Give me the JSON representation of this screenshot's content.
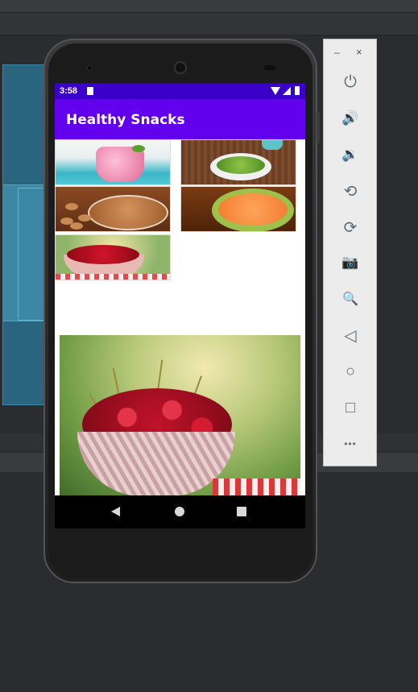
{
  "emulator": {
    "minimize_glyph": "–",
    "close_glyph": "×",
    "tools": [
      {
        "name": "power-icon",
        "glyph": "⏻"
      },
      {
        "name": "volume-up-icon",
        "glyph": "🔊"
      },
      {
        "name": "volume-down-icon",
        "glyph": "🔉"
      },
      {
        "name": "rotate-left-icon",
        "glyph": "⟲"
      },
      {
        "name": "rotate-right-icon",
        "glyph": "⟳"
      },
      {
        "name": "camera-icon",
        "glyph": "📷"
      },
      {
        "name": "zoom-icon",
        "glyph": "🔍"
      },
      {
        "name": "back-icon",
        "glyph": "◁"
      },
      {
        "name": "home-icon",
        "glyph": "○"
      },
      {
        "name": "overview-icon",
        "glyph": "□"
      },
      {
        "name": "more-icon",
        "glyph": "•••"
      }
    ]
  },
  "device": {
    "status_bar": {
      "time": "3:58"
    },
    "app": {
      "title": "Healthy Snacks",
      "accent": "#6200ee",
      "status_color": "#3a00c9"
    },
    "thumbnails": [
      "smoothie-image",
      "edamame-image",
      "almonds-image",
      "apricots-image",
      "cherries-image"
    ],
    "detail_image": "cherries-large-image"
  }
}
